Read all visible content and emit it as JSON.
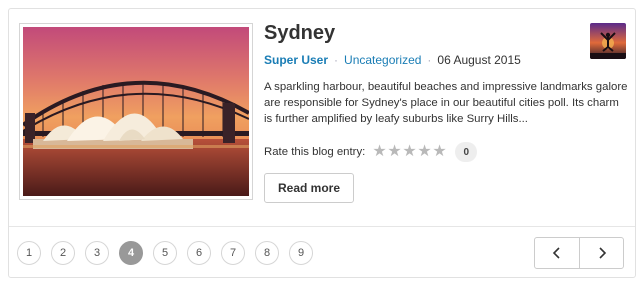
{
  "post": {
    "title": "Sydney",
    "author": "Super User",
    "category": "Uncategorized",
    "date": "06 August 2015",
    "intro": "A sparkling harbour, beautiful beaches and impressive landmarks galore are responsible for Sydney's place in our beautiful cities poll. Its charm is further amplified by leafy suburbs like Surry Hills...",
    "rating_label": "Rate this blog entry:",
    "rating_value": 0,
    "rating_max": 5,
    "rating_count": "0",
    "read_more": "Read more"
  },
  "pagination": {
    "pages": [
      "1",
      "2",
      "3",
      "4",
      "5",
      "6",
      "7",
      "8",
      "9"
    ],
    "current": "4",
    "prev_icon": "chevron-left-icon",
    "next_icon": "chevron-right-icon"
  },
  "colors": {
    "link": "#1a7db5",
    "active_page": "#999999",
    "star_empty": "#b9b9b9"
  }
}
